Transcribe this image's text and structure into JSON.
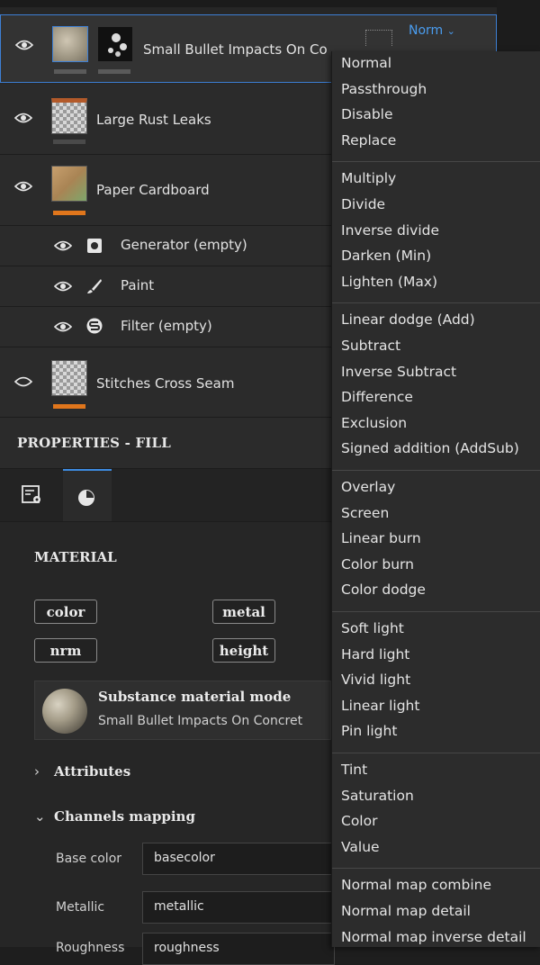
{
  "layers": [
    {
      "name": "Small Bullet Impacts On Co",
      "visible": true,
      "selected": true,
      "blend_mode": "Norm",
      "bar_color": "#5a5a5a"
    },
    {
      "name": "Large Rust Leaks",
      "visible": true,
      "selected": false,
      "bar_color": "#4a4a4a"
    },
    {
      "name": "Paper Cardboard",
      "visible": true,
      "selected": false,
      "bar_color": "#e0761c"
    },
    {
      "name": "Stitches Cross Seam",
      "visible": false,
      "selected": false,
      "bar_color": "#e0761c"
    }
  ],
  "sublayers": [
    {
      "name": "Generator (empty)",
      "icon": "generator-icon"
    },
    {
      "name": "Paint",
      "icon": "brush-icon"
    },
    {
      "name": "Filter (empty)",
      "icon": "filter-icon"
    }
  ],
  "properties": {
    "title": "PROPERTIES - FILL",
    "material_heading": "MATERIAL",
    "chips": [
      "color",
      "metal",
      "nrm",
      "height"
    ],
    "material_mode_title": "Substance material mode",
    "material_mode_name": "Small Bullet Impacts On Concret",
    "attributes_label": "Attributes",
    "channels_mapping_label": "Channels mapping",
    "channels": [
      {
        "label": "Base color",
        "value": "basecolor"
      },
      {
        "label": "Metallic",
        "value": "metallic"
      },
      {
        "label": "Roughness",
        "value": "roughness"
      }
    ]
  },
  "blend_menu": {
    "groups": [
      [
        "Normal",
        "Passthrough",
        "Disable",
        "Replace"
      ],
      [
        "Multiply",
        "Divide",
        "Inverse divide",
        "Darken (Min)",
        "Lighten (Max)"
      ],
      [
        "Linear dodge (Add)",
        "Subtract",
        "Inverse Subtract",
        "Difference",
        "Exclusion",
        "Signed addition (AddSub)"
      ],
      [
        "Overlay",
        "Screen",
        "Linear burn",
        "Color burn",
        "Color dodge"
      ],
      [
        "Soft light",
        "Hard light",
        "Vivid light",
        "Linear light",
        "Pin light"
      ],
      [
        "Tint",
        "Saturation",
        "Color",
        "Value"
      ],
      [
        "Normal map combine",
        "Normal map detail",
        "Normal map inverse detail"
      ]
    ]
  },
  "colors": {
    "accent": "#3d8be0",
    "orange_bar": "#e0761c"
  }
}
